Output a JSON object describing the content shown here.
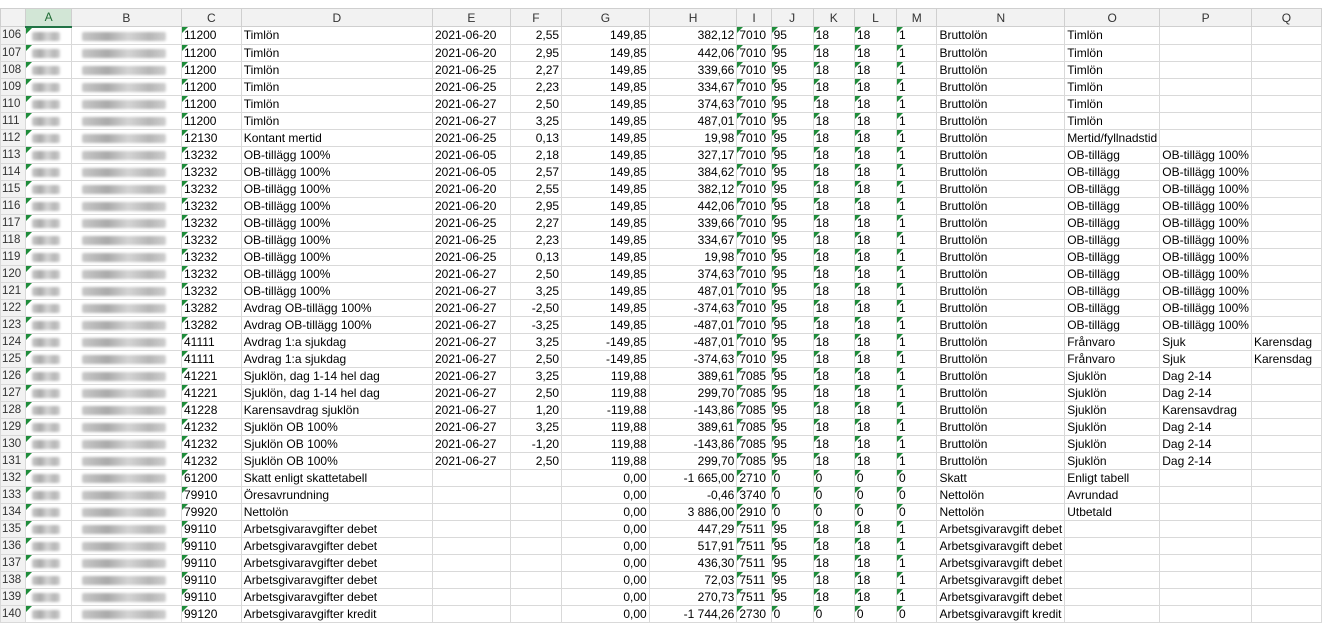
{
  "columns": [
    "A",
    "B",
    "C",
    "D",
    "E",
    "F",
    "G",
    "H",
    "I",
    "J",
    "K",
    "L",
    "M",
    "N",
    "O",
    "P",
    "Q"
  ],
  "selected_column": "A",
  "rows": [
    {
      "n": "106",
      "c": "11200",
      "d": "Timlön",
      "e": "2021-06-20",
      "f": "2,55",
      "g": "149,85",
      "h": "382,12",
      "i": "7010",
      "j": "95",
      "k": "18",
      "l": "18",
      "m": "1",
      "nn": "Bruttolön",
      "o": "Timlön",
      "p": "",
      "q": ""
    },
    {
      "n": "107",
      "c": "11200",
      "d": "Timlön",
      "e": "2021-06-20",
      "f": "2,95",
      "g": "149,85",
      "h": "442,06",
      "i": "7010",
      "j": "95",
      "k": "18",
      "l": "18",
      "m": "1",
      "nn": "Bruttolön",
      "o": "Timlön",
      "p": "",
      "q": ""
    },
    {
      "n": "108",
      "c": "11200",
      "d": "Timlön",
      "e": "2021-06-25",
      "f": "2,27",
      "g": "149,85",
      "h": "339,66",
      "i": "7010",
      "j": "95",
      "k": "18",
      "l": "18",
      "m": "1",
      "nn": "Bruttolön",
      "o": "Timlön",
      "p": "",
      "q": ""
    },
    {
      "n": "109",
      "c": "11200",
      "d": "Timlön",
      "e": "2021-06-25",
      "f": "2,23",
      "g": "149,85",
      "h": "334,67",
      "i": "7010",
      "j": "95",
      "k": "18",
      "l": "18",
      "m": "1",
      "nn": "Bruttolön",
      "o": "Timlön",
      "p": "",
      "q": ""
    },
    {
      "n": "110",
      "c": "11200",
      "d": "Timlön",
      "e": "2021-06-27",
      "f": "2,50",
      "g": "149,85",
      "h": "374,63",
      "i": "7010",
      "j": "95",
      "k": "18",
      "l": "18",
      "m": "1",
      "nn": "Bruttolön",
      "o": "Timlön",
      "p": "",
      "q": ""
    },
    {
      "n": "111",
      "c": "11200",
      "d": "Timlön",
      "e": "2021-06-27",
      "f": "3,25",
      "g": "149,85",
      "h": "487,01",
      "i": "7010",
      "j": "95",
      "k": "18",
      "l": "18",
      "m": "1",
      "nn": "Bruttolön",
      "o": "Timlön",
      "p": "",
      "q": ""
    },
    {
      "n": "112",
      "c": "12130",
      "d": "Kontant mertid",
      "e": "2021-06-25",
      "f": "0,13",
      "g": "149,85",
      "h": "19,98",
      "i": "7010",
      "j": "95",
      "k": "18",
      "l": "18",
      "m": "1",
      "nn": "Bruttolön",
      "o": "Mertid/fyllnadstid",
      "p": "",
      "q": ""
    },
    {
      "n": "113",
      "c": "13232",
      "d": "OB-tillägg 100%",
      "e": "2021-06-05",
      "f": "2,18",
      "g": "149,85",
      "h": "327,17",
      "i": "7010",
      "j": "95",
      "k": "18",
      "l": "18",
      "m": "1",
      "nn": "Bruttolön",
      "o": "OB-tillägg",
      "p": "OB-tillägg 100%",
      "q": ""
    },
    {
      "n": "114",
      "c": "13232",
      "d": "OB-tillägg 100%",
      "e": "2021-06-05",
      "f": "2,57",
      "g": "149,85",
      "h": "384,62",
      "i": "7010",
      "j": "95",
      "k": "18",
      "l": "18",
      "m": "1",
      "nn": "Bruttolön",
      "o": "OB-tillägg",
      "p": "OB-tillägg 100%",
      "q": ""
    },
    {
      "n": "115",
      "c": "13232",
      "d": "OB-tillägg 100%",
      "e": "2021-06-20",
      "f": "2,55",
      "g": "149,85",
      "h": "382,12",
      "i": "7010",
      "j": "95",
      "k": "18",
      "l": "18",
      "m": "1",
      "nn": "Bruttolön",
      "o": "OB-tillägg",
      "p": "OB-tillägg 100%",
      "q": ""
    },
    {
      "n": "116",
      "c": "13232",
      "d": "OB-tillägg 100%",
      "e": "2021-06-20",
      "f": "2,95",
      "g": "149,85",
      "h": "442,06",
      "i": "7010",
      "j": "95",
      "k": "18",
      "l": "18",
      "m": "1",
      "nn": "Bruttolön",
      "o": "OB-tillägg",
      "p": "OB-tillägg 100%",
      "q": ""
    },
    {
      "n": "117",
      "c": "13232",
      "d": "OB-tillägg 100%",
      "e": "2021-06-25",
      "f": "2,27",
      "g": "149,85",
      "h": "339,66",
      "i": "7010",
      "j": "95",
      "k": "18",
      "l": "18",
      "m": "1",
      "nn": "Bruttolön",
      "o": "OB-tillägg",
      "p": "OB-tillägg 100%",
      "q": ""
    },
    {
      "n": "118",
      "c": "13232",
      "d": "OB-tillägg 100%",
      "e": "2021-06-25",
      "f": "2,23",
      "g": "149,85",
      "h": "334,67",
      "i": "7010",
      "j": "95",
      "k": "18",
      "l": "18",
      "m": "1",
      "nn": "Bruttolön",
      "o": "OB-tillägg",
      "p": "OB-tillägg 100%",
      "q": ""
    },
    {
      "n": "119",
      "c": "13232",
      "d": "OB-tillägg 100%",
      "e": "2021-06-25",
      "f": "0,13",
      "g": "149,85",
      "h": "19,98",
      "i": "7010",
      "j": "95",
      "k": "18",
      "l": "18",
      "m": "1",
      "nn": "Bruttolön",
      "o": "OB-tillägg",
      "p": "OB-tillägg 100%",
      "q": ""
    },
    {
      "n": "120",
      "c": "13232",
      "d": "OB-tillägg 100%",
      "e": "2021-06-27",
      "f": "2,50",
      "g": "149,85",
      "h": "374,63",
      "i": "7010",
      "j": "95",
      "k": "18",
      "l": "18",
      "m": "1",
      "nn": "Bruttolön",
      "o": "OB-tillägg",
      "p": "OB-tillägg 100%",
      "q": ""
    },
    {
      "n": "121",
      "c": "13232",
      "d": "OB-tillägg 100%",
      "e": "2021-06-27",
      "f": "3,25",
      "g": "149,85",
      "h": "487,01",
      "i": "7010",
      "j": "95",
      "k": "18",
      "l": "18",
      "m": "1",
      "nn": "Bruttolön",
      "o": "OB-tillägg",
      "p": "OB-tillägg 100%",
      "q": ""
    },
    {
      "n": "122",
      "c": "13282",
      "d": "Avdrag OB-tillägg 100%",
      "e": "2021-06-27",
      "f": "-2,50",
      "g": "149,85",
      "h": "-374,63",
      "i": "7010",
      "j": "95",
      "k": "18",
      "l": "18",
      "m": "1",
      "nn": "Bruttolön",
      "o": "OB-tillägg",
      "p": "OB-tillägg 100%",
      "q": ""
    },
    {
      "n": "123",
      "c": "13282",
      "d": "Avdrag OB-tillägg 100%",
      "e": "2021-06-27",
      "f": "-3,25",
      "g": "149,85",
      "h": "-487,01",
      "i": "7010",
      "j": "95",
      "k": "18",
      "l": "18",
      "m": "1",
      "nn": "Bruttolön",
      "o": "OB-tillägg",
      "p": "OB-tillägg 100%",
      "q": ""
    },
    {
      "n": "124",
      "c": "41111",
      "d": "Avdrag 1:a sjukdag",
      "e": "2021-06-27",
      "f": "3,25",
      "g": "-149,85",
      "h": "-487,01",
      "i": "7010",
      "j": "95",
      "k": "18",
      "l": "18",
      "m": "1",
      "nn": "Bruttolön",
      "o": "Frånvaro",
      "p": "Sjuk",
      "q": "Karensdag"
    },
    {
      "n": "125",
      "c": "41111",
      "d": "Avdrag 1:a sjukdag",
      "e": "2021-06-27",
      "f": "2,50",
      "g": "-149,85",
      "h": "-374,63",
      "i": "7010",
      "j": "95",
      "k": "18",
      "l": "18",
      "m": "1",
      "nn": "Bruttolön",
      "o": "Frånvaro",
      "p": "Sjuk",
      "q": "Karensdag"
    },
    {
      "n": "126",
      "c": "41221",
      "d": "Sjuklön, dag 1-14 hel dag",
      "e": "2021-06-27",
      "f": "3,25",
      "g": "119,88",
      "h": "389,61",
      "i": "7085",
      "j": "95",
      "k": "18",
      "l": "18",
      "m": "1",
      "nn": "Bruttolön",
      "o": "Sjuklön",
      "p": "Dag 2-14",
      "q": ""
    },
    {
      "n": "127",
      "c": "41221",
      "d": "Sjuklön, dag 1-14 hel dag",
      "e": "2021-06-27",
      "f": "2,50",
      "g": "119,88",
      "h": "299,70",
      "i": "7085",
      "j": "95",
      "k": "18",
      "l": "18",
      "m": "1",
      "nn": "Bruttolön",
      "o": "Sjuklön",
      "p": "Dag 2-14",
      "q": ""
    },
    {
      "n": "128",
      "c": "41228",
      "d": "Karensavdrag sjuklön",
      "e": "2021-06-27",
      "f": "1,20",
      "g": "-119,88",
      "h": "-143,86",
      "i": "7085",
      "j": "95",
      "k": "18",
      "l": "18",
      "m": "1",
      "nn": "Bruttolön",
      "o": "Sjuklön",
      "p": "Karensavdrag",
      "q": ""
    },
    {
      "n": "129",
      "c": "41232",
      "d": "Sjuklön OB 100%",
      "e": "2021-06-27",
      "f": "3,25",
      "g": "119,88",
      "h": "389,61",
      "i": "7085",
      "j": "95",
      "k": "18",
      "l": "18",
      "m": "1",
      "nn": "Bruttolön",
      "o": "Sjuklön",
      "p": "Dag 2-14",
      "q": ""
    },
    {
      "n": "130",
      "c": "41232",
      "d": "Sjuklön OB 100%",
      "e": "2021-06-27",
      "f": "-1,20",
      "g": "119,88",
      "h": "-143,86",
      "i": "7085",
      "j": "95",
      "k": "18",
      "l": "18",
      "m": "1",
      "nn": "Bruttolön",
      "o": "Sjuklön",
      "p": "Dag 2-14",
      "q": ""
    },
    {
      "n": "131",
      "c": "41232",
      "d": "Sjuklön OB 100%",
      "e": "2021-06-27",
      "f": "2,50",
      "g": "119,88",
      "h": "299,70",
      "i": "7085",
      "j": "95",
      "k": "18",
      "l": "18",
      "m": "1",
      "nn": "Bruttolön",
      "o": "Sjuklön",
      "p": "Dag 2-14",
      "q": ""
    },
    {
      "n": "132",
      "c": "61200",
      "d": "Skatt enligt skattetabell",
      "e": "",
      "f": "",
      "g": "0,00",
      "h": "-1 665,00",
      "i": "2710",
      "j": "0",
      "k": "0",
      "l": "0",
      "m": "0",
      "nn": "Skatt",
      "o": "Enligt tabell",
      "p": "",
      "q": ""
    },
    {
      "n": "133",
      "c": "79910",
      "d": "Öresavrundning",
      "e": "",
      "f": "",
      "g": "0,00",
      "h": "-0,46",
      "i": "3740",
      "j": "0",
      "k": "0",
      "l": "0",
      "m": "0",
      "nn": "Nettolön",
      "o": "Avrundad",
      "p": "",
      "q": ""
    },
    {
      "n": "134",
      "c": "79920",
      "d": "Nettolön",
      "e": "",
      "f": "",
      "g": "0,00",
      "h": "3 886,00",
      "i": "2910",
      "j": "0",
      "k": "0",
      "l": "0",
      "m": "0",
      "nn": "Nettolön",
      "o": "Utbetald",
      "p": "",
      "q": ""
    },
    {
      "n": "135",
      "c": "99110",
      "d": "Arbetsgivaravgifter debet",
      "e": "",
      "f": "",
      "g": "0,00",
      "h": "447,29",
      "i": "7511",
      "j": "95",
      "k": "18",
      "l": "18",
      "m": "1",
      "nn": "Arbetsgivaravgift debet",
      "o": "",
      "p": "",
      "q": ""
    },
    {
      "n": "136",
      "c": "99110",
      "d": "Arbetsgivaravgifter debet",
      "e": "",
      "f": "",
      "g": "0,00",
      "h": "517,91",
      "i": "7511",
      "j": "95",
      "k": "18",
      "l": "18",
      "m": "1",
      "nn": "Arbetsgivaravgift debet",
      "o": "",
      "p": "",
      "q": ""
    },
    {
      "n": "137",
      "c": "99110",
      "d": "Arbetsgivaravgifter debet",
      "e": "",
      "f": "",
      "g": "0,00",
      "h": "436,30",
      "i": "7511",
      "j": "95",
      "k": "18",
      "l": "18",
      "m": "1",
      "nn": "Arbetsgivaravgift debet",
      "o": "",
      "p": "",
      "q": ""
    },
    {
      "n": "138",
      "c": "99110",
      "d": "Arbetsgivaravgifter debet",
      "e": "",
      "f": "",
      "g": "0,00",
      "h": "72,03",
      "i": "7511",
      "j": "95",
      "k": "18",
      "l": "18",
      "m": "1",
      "nn": "Arbetsgivaravgift debet",
      "o": "",
      "p": "",
      "q": ""
    },
    {
      "n": "139",
      "c": "99110",
      "d": "Arbetsgivaravgifter debet",
      "e": "",
      "f": "",
      "g": "0,00",
      "h": "270,73",
      "i": "7511",
      "j": "95",
      "k": "18",
      "l": "18",
      "m": "1",
      "nn": "Arbetsgivaravgift debet",
      "o": "",
      "p": "",
      "q": ""
    },
    {
      "n": "140",
      "c": "99120",
      "d": "Arbetsgivaravgifter kredit",
      "e": "",
      "f": "",
      "g": "0,00",
      "h": "-1 744,26",
      "i": "2730",
      "j": "0",
      "k": "0",
      "l": "0",
      "m": "0",
      "nn": "Arbetsgivaravgift kredit",
      "o": "",
      "p": "",
      "q": ""
    }
  ]
}
